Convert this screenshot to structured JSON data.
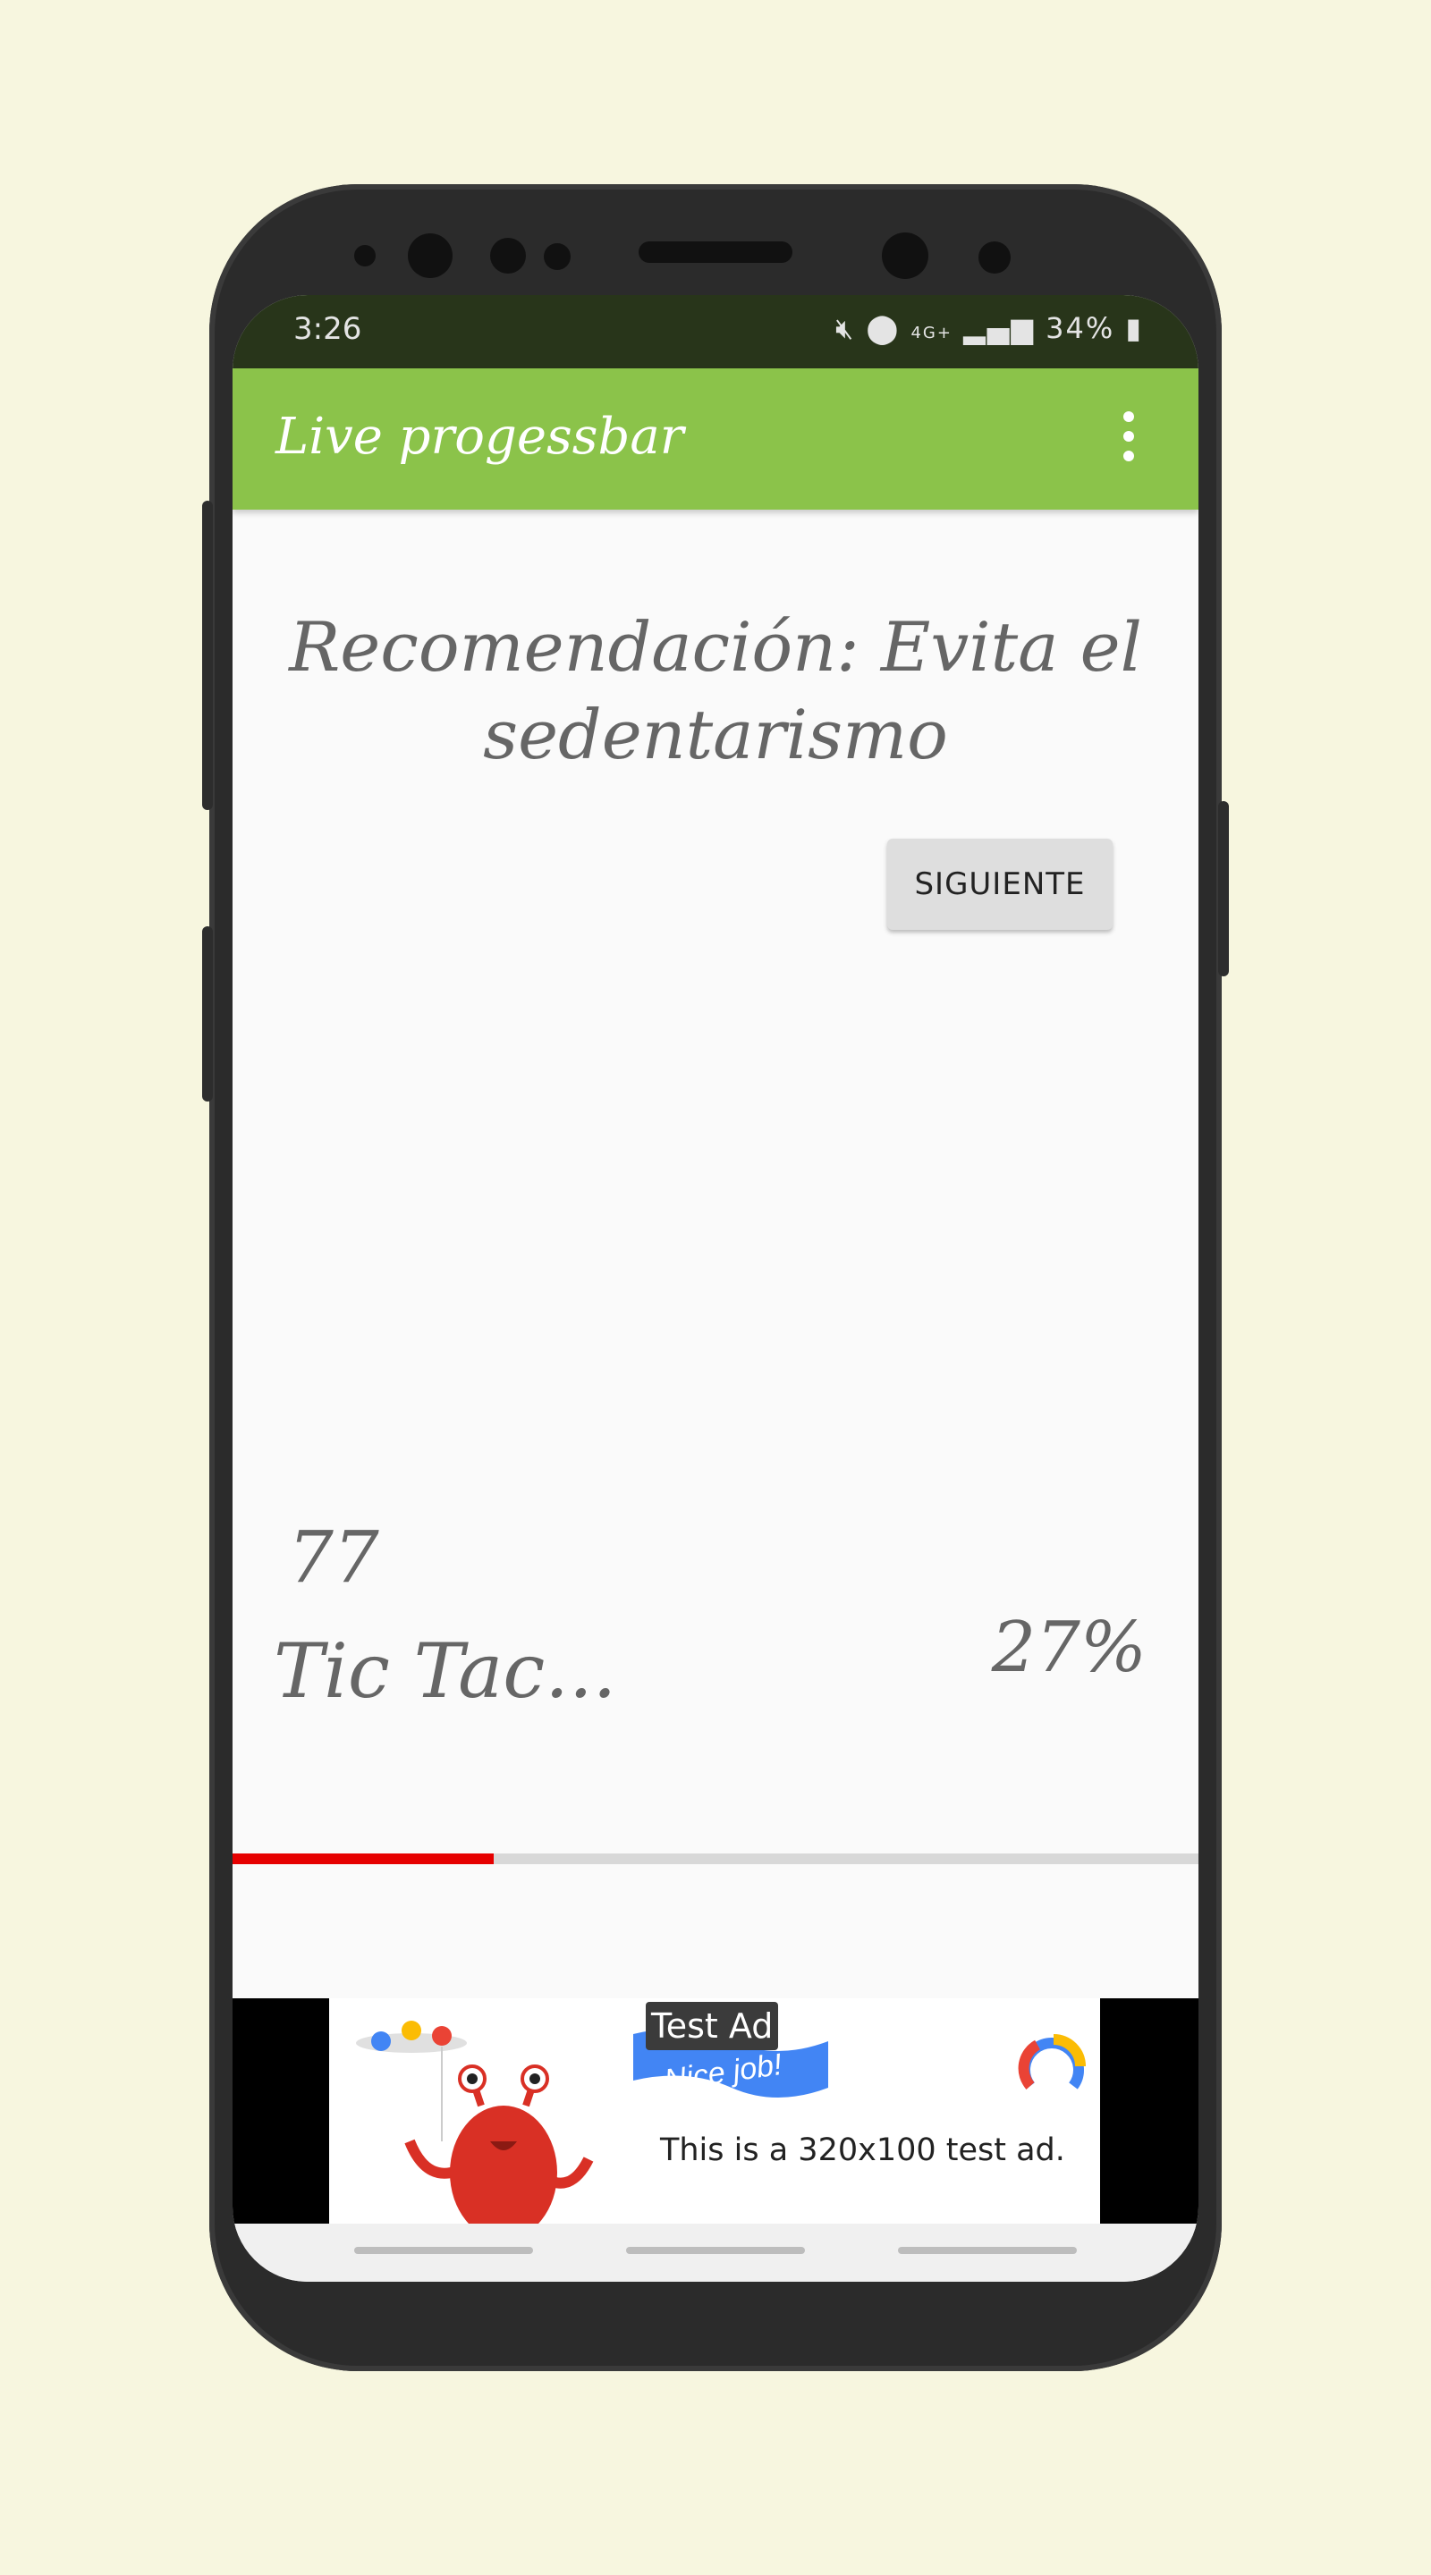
{
  "status_bar": {
    "time": "3:26",
    "icons": [
      "mute-icon",
      "location-icon",
      "4g-icon",
      "signal-icon",
      "battery-icon"
    ],
    "network": "4G+",
    "battery": "34%"
  },
  "app_bar": {
    "title": "Live progessbar",
    "overflow_icon": "more-vert-icon"
  },
  "content": {
    "recommendation": "Recomendación: Evita el sedentarismo",
    "next_button": "SIGUIENTE",
    "counter": "77",
    "status_text": "Tic Tac...",
    "percent_label": "27%",
    "progress": 0.27
  },
  "ad": {
    "tag": "Test Ad",
    "banner_text": "Nice job!",
    "body_text": "This is a 320x100 test ad."
  },
  "colors": {
    "app_bar": "#8bc34a",
    "status_bar": "#28351a",
    "progress_fill": "#e60000",
    "progress_track": "#d8d8d8",
    "page_background": "#f7f6df"
  }
}
